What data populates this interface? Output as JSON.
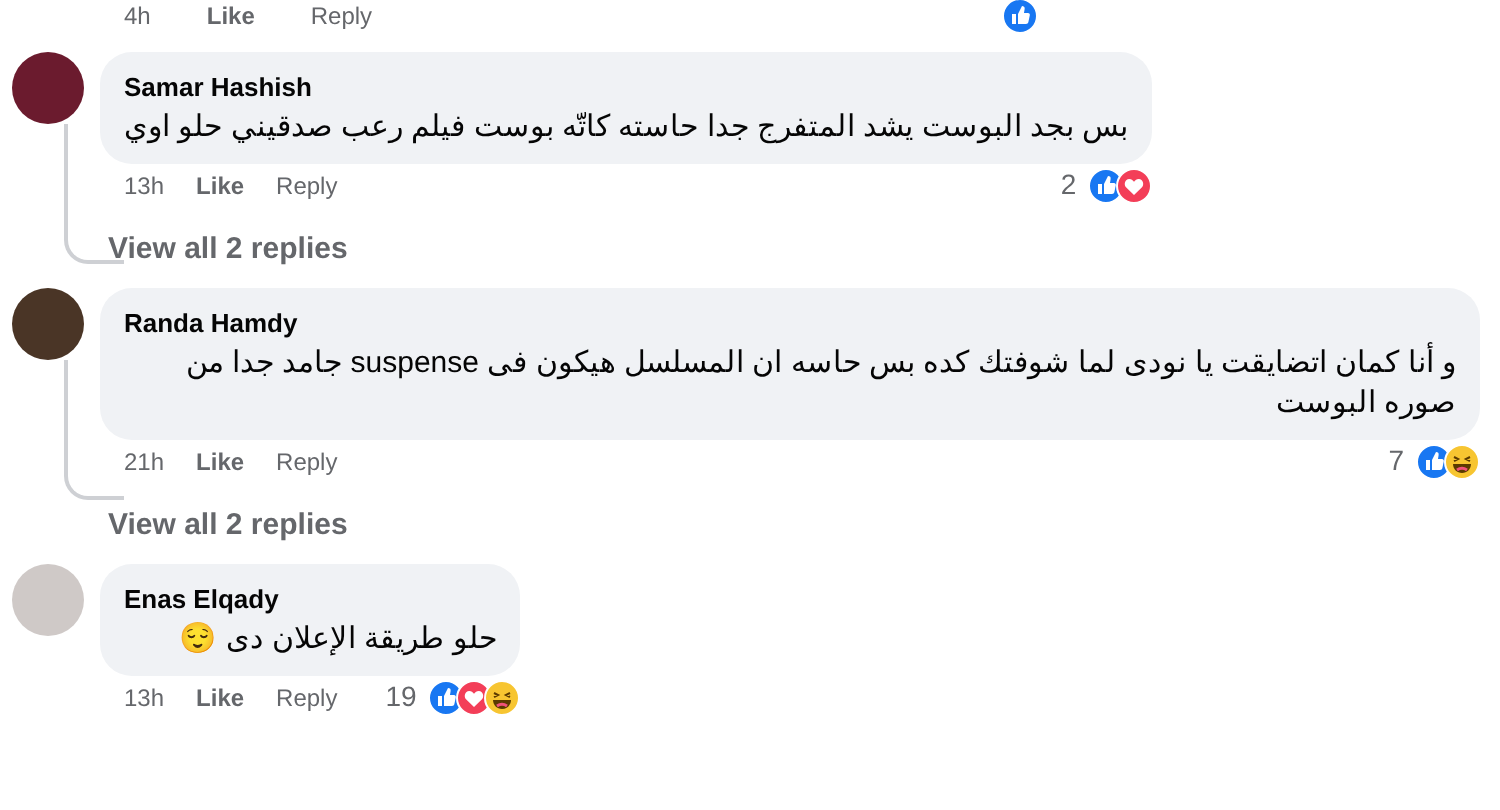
{
  "previous_comment": {
    "time": "4h",
    "like": "Like",
    "reply": "Reply",
    "reactions": {
      "like": true,
      "love": false,
      "haha": false
    }
  },
  "comments": [
    {
      "author": "Samar Hashish",
      "text": "بس بجد البوست يشد المتفرج جدا حاسته كاتّه بوست فيلم رعب صدقيني حلو اوي",
      "time": "13h",
      "like": "Like",
      "reply": "Reply",
      "reaction_count": "2",
      "reactions": {
        "like": true,
        "love": true,
        "haha": false
      },
      "replies_link": "View all 2 replies"
    },
    {
      "author": "Randa Hamdy",
      "text": "و أنا كمان اتضايقت يا نودى لما شوفتك كده بس حاسه ان المسلسل هيكون فى suspense جامد جدا من صوره البوست",
      "time": "21h",
      "like": "Like",
      "reply": "Reply",
      "reaction_count": "7",
      "reactions": {
        "like": true,
        "love": false,
        "haha": true
      },
      "replies_link": "View all 2 replies"
    },
    {
      "author": "Enas Elqady",
      "text": "حلو طريقة الإعلان دى 😌",
      "time": "13h",
      "like": "Like",
      "reply": "Reply",
      "reaction_count": "19",
      "reactions": {
        "like": true,
        "love": true,
        "haha": true
      }
    }
  ]
}
